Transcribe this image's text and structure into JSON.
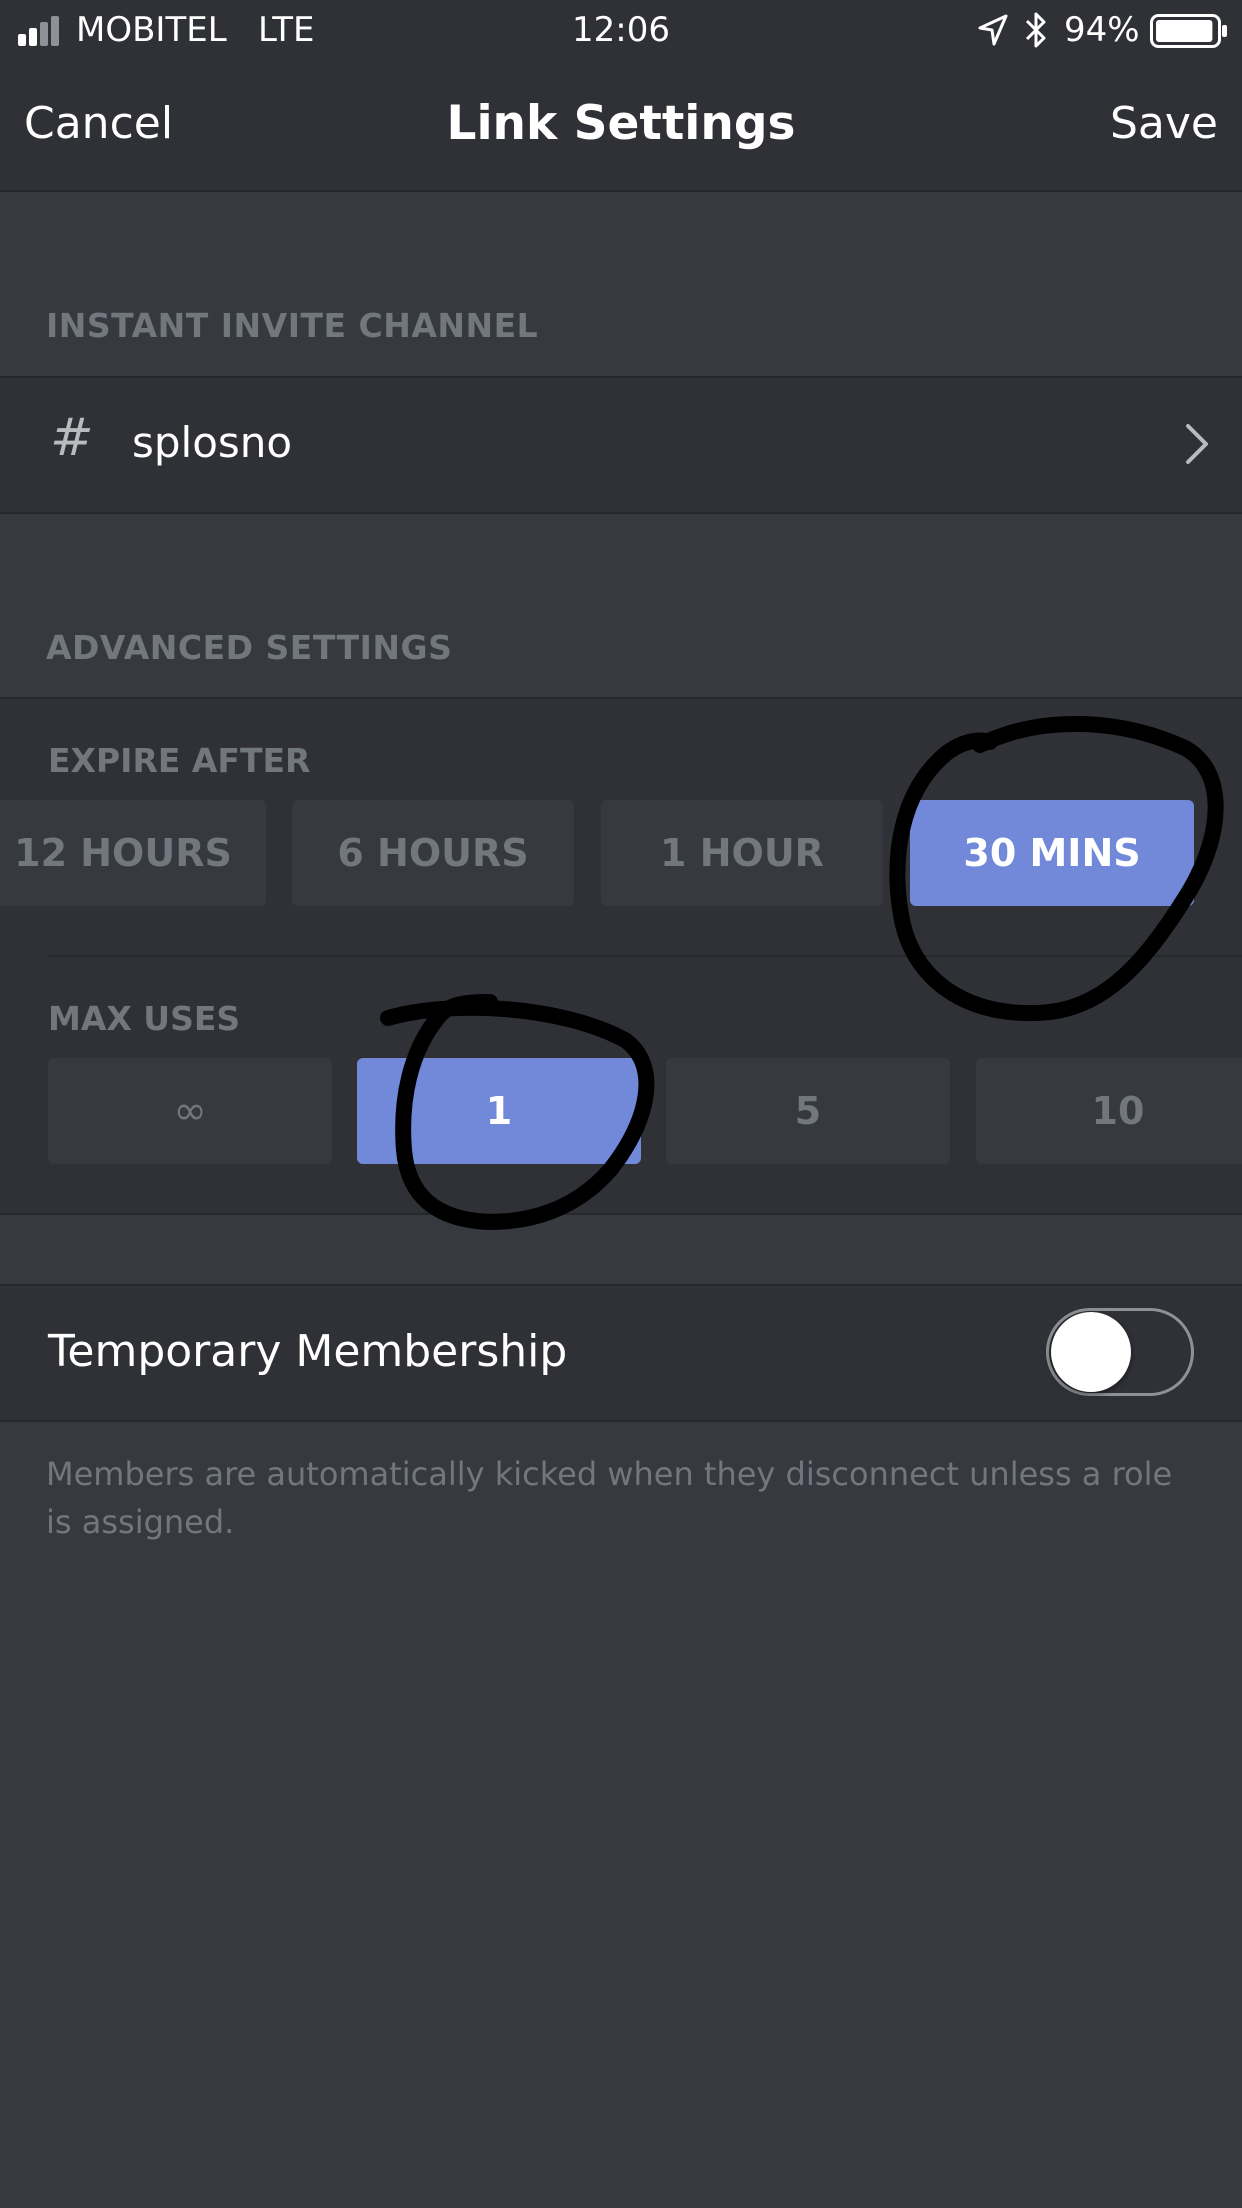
{
  "status_bar": {
    "carrier": "MOBITEL",
    "network": "LTE",
    "time": "12:06",
    "battery": "94%",
    "battery_level": 0.94,
    "icons": [
      "signal-icon",
      "location-icon",
      "bluetooth-icon",
      "battery-icon"
    ]
  },
  "nav": {
    "cancel": "Cancel",
    "title": "Link Settings",
    "save": "Save"
  },
  "instant_invite": {
    "section_label": "INSTANT INVITE CHANNEL",
    "channel_prefix": "#",
    "channel_name": "splosno"
  },
  "advanced": {
    "section_label": "ADVANCED SETTINGS",
    "expire_after": {
      "label": "EXPIRE AFTER",
      "options": [
        "12 HOURS",
        "6 HOURS",
        "1 HOUR",
        "30 MINS"
      ],
      "selected": "30 MINS"
    },
    "max_uses": {
      "label": "MAX USES",
      "options": [
        "∞",
        "1",
        "5",
        "10"
      ],
      "selected": "1"
    }
  },
  "temporary_membership": {
    "label": "Temporary Membership",
    "enabled": false,
    "helper": "Members are automatically kicked when they disconnect unless a role is assigned."
  },
  "colors": {
    "background": "#36393f",
    "panel": "#2f3136",
    "accent": "#7289da",
    "muted_text": "#72767d"
  }
}
